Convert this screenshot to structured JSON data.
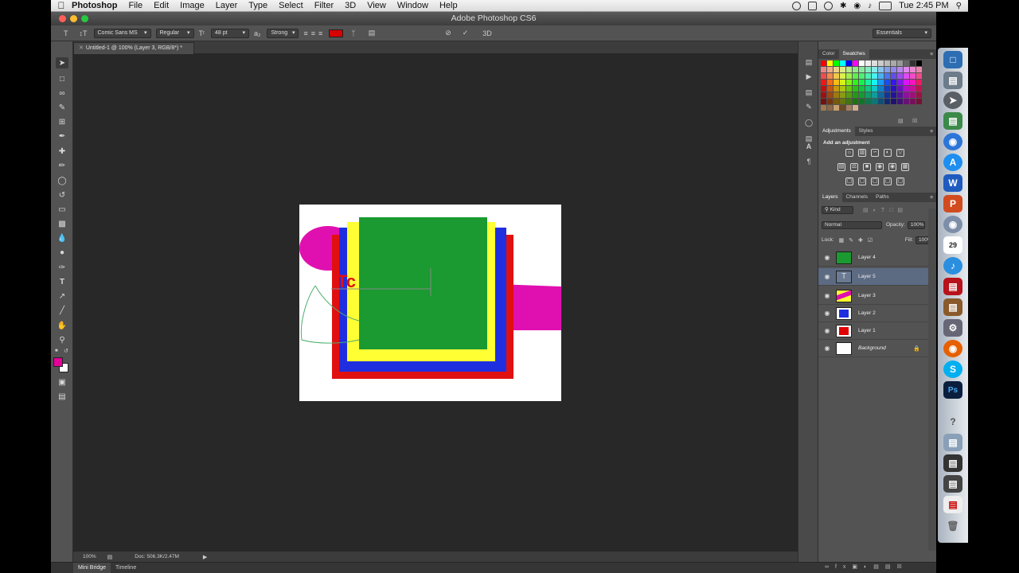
{
  "window": {
    "title": "Adobe Photoshop CS6"
  },
  "menubar": {
    "app_name": "Photoshop",
    "items": [
      "File",
      "Edit",
      "Image",
      "Layer",
      "Type",
      "Select",
      "Filter",
      "3D",
      "View",
      "Window",
      "Help"
    ],
    "clock": "Tue 2:45 PM"
  },
  "options_bar": {
    "font_family": "Comic Sans MS",
    "font_style": "Regular",
    "font_size": "48 pt",
    "antialias": "Strong",
    "text_color": "#d60000",
    "mode_3d": "3D",
    "workspace": "Essentials"
  },
  "document": {
    "tab_title": "Untitled-1 @ 100% (Layer 3, RGB/8*) *",
    "zoom": "100%",
    "doc_size": "Doc: 506.3K/2.47M",
    "canvas_text_fragment": "Tc"
  },
  "bottom_tabs": [
    "Mini Bridge",
    "Timeline"
  ],
  "panels": {
    "color_tabs": [
      "Color",
      "Swatches"
    ],
    "adjustment_tabs": [
      "Adjustments",
      "Styles"
    ],
    "adjustment_hint": "Add an adjustment",
    "layers_tabs": [
      "Layers",
      "Channels",
      "Paths"
    ],
    "kind_filter": "Kind",
    "blend_mode": "Normal",
    "opacity_label": "Opacity:",
    "opacity_value": "100%",
    "lock_label": "Lock:",
    "fill_label": "Fill:",
    "fill_value": "100%"
  },
  "layers": [
    {
      "name": "Layer 4",
      "kind": "fill",
      "color": "#1a9a30",
      "selected": false
    },
    {
      "name": "Layer 5",
      "kind": "text",
      "color": "#ffffff",
      "selected": true
    },
    {
      "name": "Layer 3",
      "kind": "stripes",
      "color": "#ffff33",
      "selected": false
    },
    {
      "name": "Layer 2",
      "kind": "fill",
      "color": "#1f2fe0",
      "selected": false
    },
    {
      "name": "Layer 1",
      "kind": "fill",
      "color": "#e00000",
      "selected": false
    },
    {
      "name": "Background",
      "kind": "fill",
      "color": "#ffffff",
      "selected": false,
      "locked": true
    }
  ],
  "tools": [
    "move-tool",
    "marquee-tool",
    "lasso-tool",
    "quick-selection-tool",
    "crop-tool",
    "eyedropper-tool",
    "healing-brush-tool",
    "brush-tool",
    "clone-stamp-tool",
    "history-brush-tool",
    "eraser-tool",
    "gradient-tool",
    "blur-tool",
    "dodge-tool",
    "pen-tool",
    "type-tool",
    "path-selection-tool",
    "shape-tool",
    "hand-tool",
    "zoom-tool"
  ],
  "colors": {
    "foreground": "#e6009a",
    "background": "#ffffff"
  }
}
